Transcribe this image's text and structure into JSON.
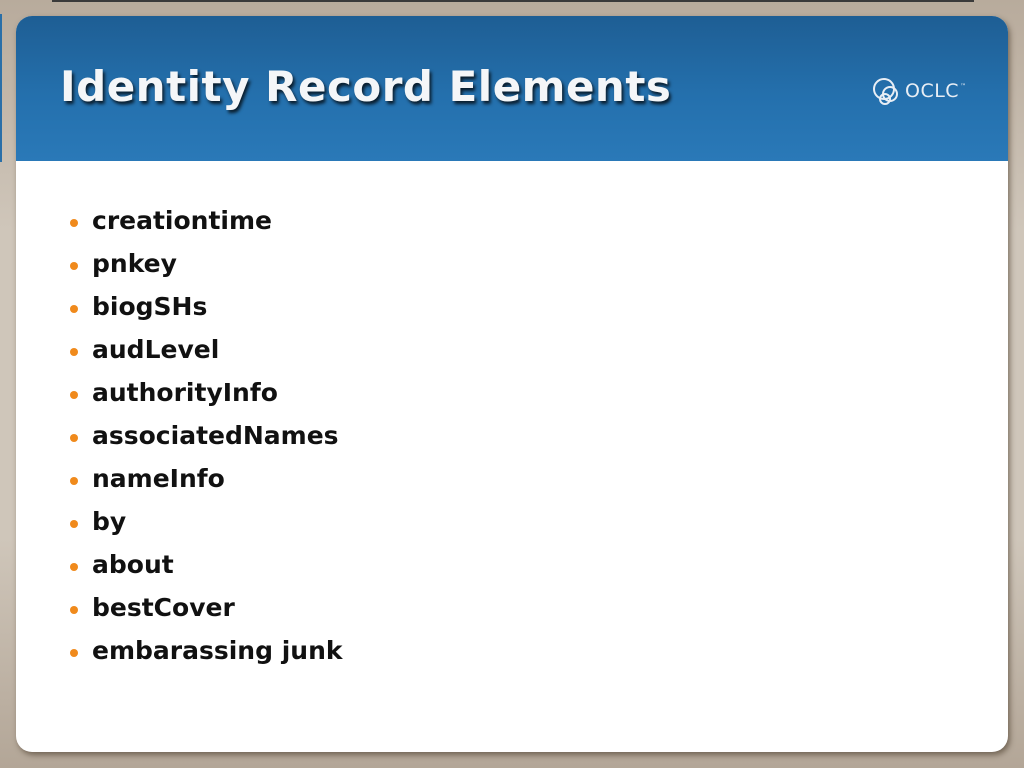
{
  "slide": {
    "title": "Identity Record Elements",
    "logo": {
      "name": "oclc-logo-icon",
      "text": "OCLC",
      "trademark": "™"
    },
    "bullets": [
      "creationtime",
      "pnkey",
      "biogSHs",
      "audLevel",
      "authorityInfo",
      "associatedNames",
      "nameInfo",
      "by",
      "about",
      "bestCover",
      "embarassing junk"
    ]
  },
  "colors": {
    "header_blue": "#2470ad",
    "bullet_orange": "#f08a1c",
    "frame_tan": "#cfc6ba",
    "text_dark": "#111111"
  }
}
